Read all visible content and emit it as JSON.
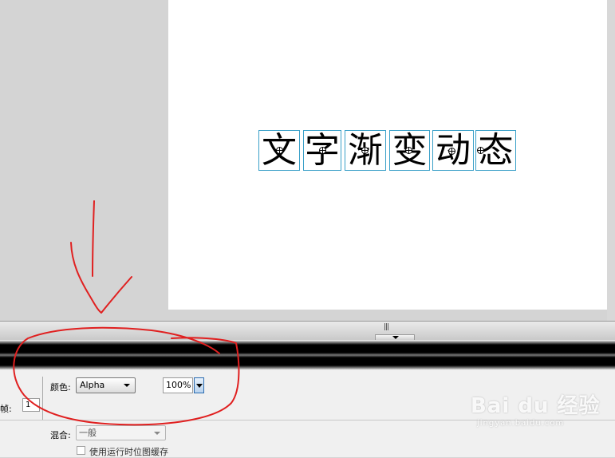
{
  "stage": {
    "characters": [
      "文",
      "字",
      "渐",
      "变",
      "动",
      "态"
    ]
  },
  "properties": {
    "frame_label": "帧:",
    "frame_value": "1",
    "color_label": "颜色:",
    "color_value": "Alpha",
    "alpha_value": "100%",
    "blend_label": "混合:",
    "blend_value": "一般",
    "cache_label": "使用运行时位图缓存"
  },
  "splitter": {
    "grip_text": "|||"
  },
  "watermark": {
    "logo": "Bai du 经验",
    "url": "jingyan.baidu.com"
  },
  "colors": {
    "selection_box": "#3aa0c8",
    "annotation": "#e02020",
    "stage_bg": "#ffffff",
    "workspace_bg": "#d4d4d4"
  },
  "icons": [
    "registration-point-icon",
    "dropdown-arrow-icon"
  ]
}
